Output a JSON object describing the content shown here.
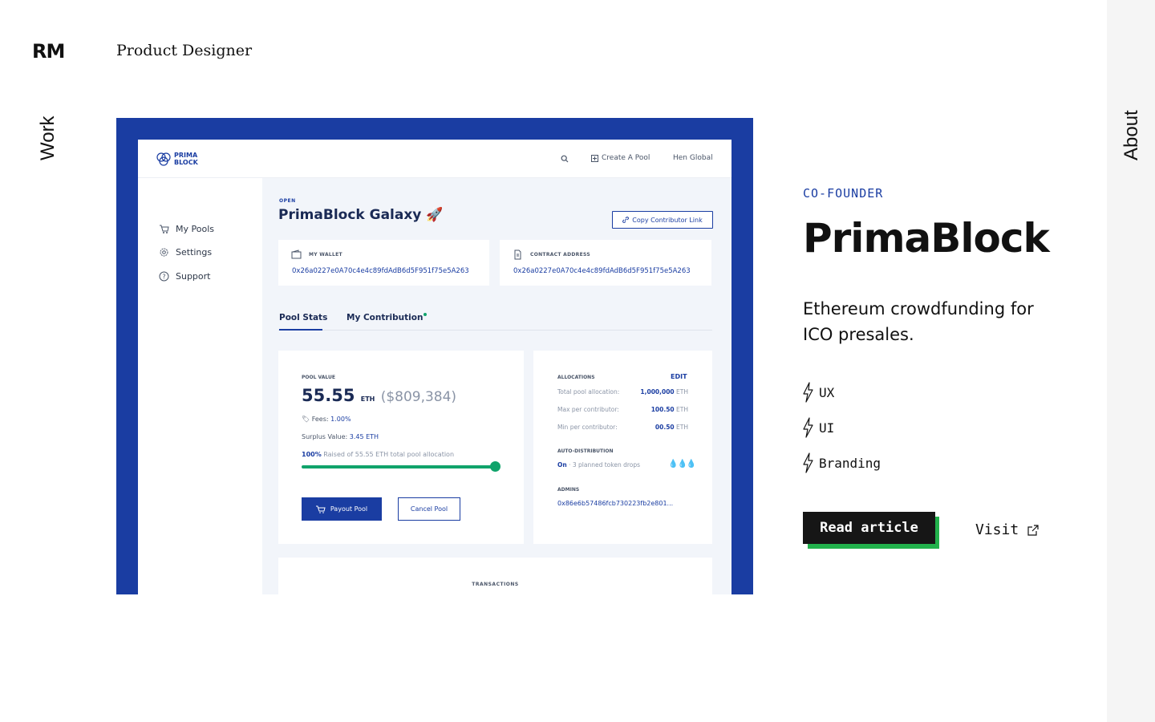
{
  "header": {
    "logo": "RM",
    "subtitle": "Product Designer"
  },
  "nav": {
    "work": "Work",
    "about": "About"
  },
  "preview": {
    "brand_line1": "PRIMA",
    "brand_line2": "BLOCK",
    "create_pool": "Create A Pool",
    "user": "Hen Global",
    "sidebar": [
      "My Pools",
      "Settings",
      "Support"
    ],
    "status": "OPEN",
    "pool_title": "PrimaBlock Galaxy 🚀",
    "copy_link": "Copy Contributor Link",
    "wallet_label": "MY WALLET",
    "wallet_addr": "0x26a0227e0A70c4e4c89fdAdB6d5F951f75e5A263",
    "contract_label": "CONTRACT ADDRESS",
    "contract_addr": "0x26a0227e0A70c4e4c89fdAdB6d5F951f75e5A263",
    "tab_stats": "Pool Stats",
    "tab_contrib": "My Contribution",
    "pool_value_label": "POOL VALUE",
    "pool_value": "55.55",
    "pool_unit": "ETH",
    "pool_usd": "($809,384)",
    "fees_label": "Fees:",
    "fees_value": "1.00%",
    "surplus_label": "Surplus Value:",
    "surplus_value": "3.45 ETH",
    "raised_pct": "100%",
    "raised_text": "Raised of 55.55 ETH total pool allocation",
    "progress": 1.0,
    "payout": "Payout Pool",
    "cancel": "Cancel Pool",
    "alloc_label": "ALLOCATIONS",
    "edit": "EDIT",
    "alloc_rows": [
      {
        "label": "Total pool allocation:",
        "value": "1,000,000",
        "unit": "ETH"
      },
      {
        "label": "Max per contributor:",
        "value": "100.50",
        "unit": "ETH"
      },
      {
        "label": "Min per contributor:",
        "value": "00.50",
        "unit": "ETH"
      }
    ],
    "auto_label": "AUTO-DISTRIBUTION",
    "auto_on": "On",
    "auto_text": " · 3 planned token drops",
    "drops": "💧💧💧",
    "admins_label": "ADMINS",
    "admins_value": "0x86e6b57486fcb730223fb2e801...",
    "transactions": "TRANSACTIONS"
  },
  "project": {
    "role": "CO-FOUNDER",
    "title": "PrimaBlock",
    "description": "Ethereum crowdfunding for ICO presales.",
    "skills": [
      "UX",
      "UI",
      "Branding"
    ],
    "read_article": "Read article",
    "visit": "Visit"
  },
  "colors": {
    "accent": "#1a3da2",
    "button": "#161616",
    "button_shadow": "#22b24c",
    "rail": "#f5f5f5"
  }
}
